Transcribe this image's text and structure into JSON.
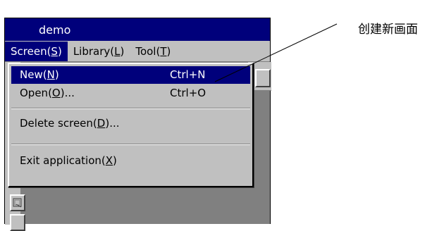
{
  "window": {
    "title": "demo"
  },
  "menubar": [
    {
      "prefix": "Screen(",
      "accel": "S",
      "suffix": ")",
      "active": true
    },
    {
      "prefix": "Library(",
      "accel": "L",
      "suffix": ")",
      "active": false
    },
    {
      "prefix": "Tool(",
      "accel": "T",
      "suffix": ")",
      "active": false
    }
  ],
  "menu": {
    "new": {
      "prefix": "New(",
      "accel": "N",
      "suffix": ")",
      "shortcut": "Ctrl+N"
    },
    "open": {
      "prefix": "Open(",
      "accel": "O",
      "suffix": ")...",
      "shortcut": "Ctrl+O"
    },
    "delete": {
      "prefix": "Delete screen(",
      "accel": "D",
      "suffix": ")..."
    },
    "exit": {
      "prefix": "Exit application(",
      "accel": "X",
      "suffix": ")"
    }
  },
  "annotation": {
    "text": "创建新画面"
  },
  "icons": {
    "left_tool": "graph-icon",
    "toolbar_button": "toolbar-button-icon"
  }
}
